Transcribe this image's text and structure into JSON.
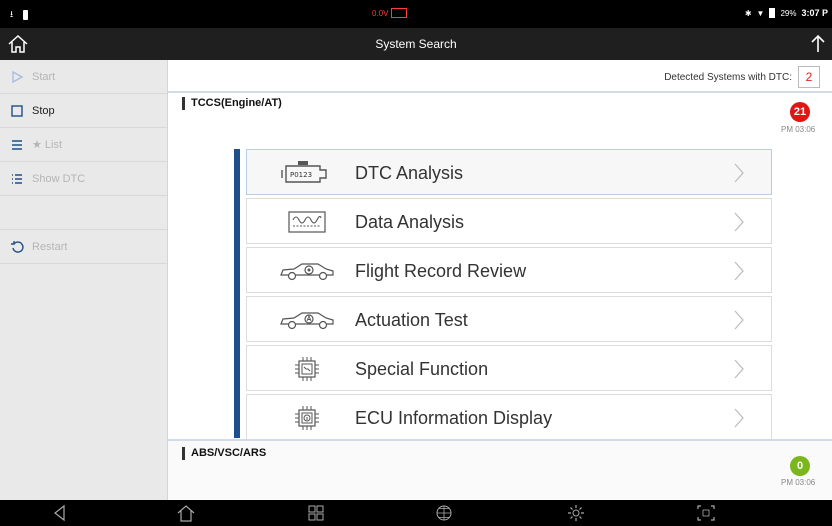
{
  "statusbar": {
    "voltage": "0.0V",
    "battery": "29%",
    "time": "3:07 P"
  },
  "header": {
    "title": "System Search"
  },
  "sidebar": {
    "items": [
      {
        "label": "Start",
        "icon": "play-icon",
        "enabled": false
      },
      {
        "label": "Stop",
        "icon": "stop-icon",
        "enabled": true
      },
      {
        "label": "★ List",
        "icon": "menu-icon",
        "enabled": false
      },
      {
        "label": "Show DTC",
        "icon": "list-icon",
        "enabled": false
      },
      {
        "label": "Restart",
        "icon": "restart-icon",
        "enabled": false
      }
    ]
  },
  "main": {
    "detected_label": "Detected Systems with DTC:",
    "detected_count": "2",
    "sections": [
      {
        "title": "TCCS(Engine/AT)",
        "badge": "21",
        "time": "PM 03:06",
        "color": "#e01515"
      },
      {
        "title": "ABS/VSC/ARS",
        "badge": "0",
        "time": "PM 03:06",
        "color": "#7ab61c"
      }
    ],
    "menu": [
      {
        "label": "DTC Analysis",
        "icon": "dtc-icon",
        "icon_text": "P0123"
      },
      {
        "label": "Data Analysis",
        "icon": "waveform-icon"
      },
      {
        "label": "Flight Record Review",
        "icon": "car-record-icon"
      },
      {
        "label": "Actuation Test",
        "icon": "car-actuation-icon"
      },
      {
        "label": "Special Function",
        "icon": "chip-function-icon"
      },
      {
        "label": "ECU Information Display",
        "icon": "chip-info-icon"
      }
    ]
  },
  "navbar": {
    "buttons": [
      "back-icon",
      "home-icon",
      "apps-icon",
      "globe-icon",
      "settings-icon",
      "screenshot-icon"
    ]
  }
}
